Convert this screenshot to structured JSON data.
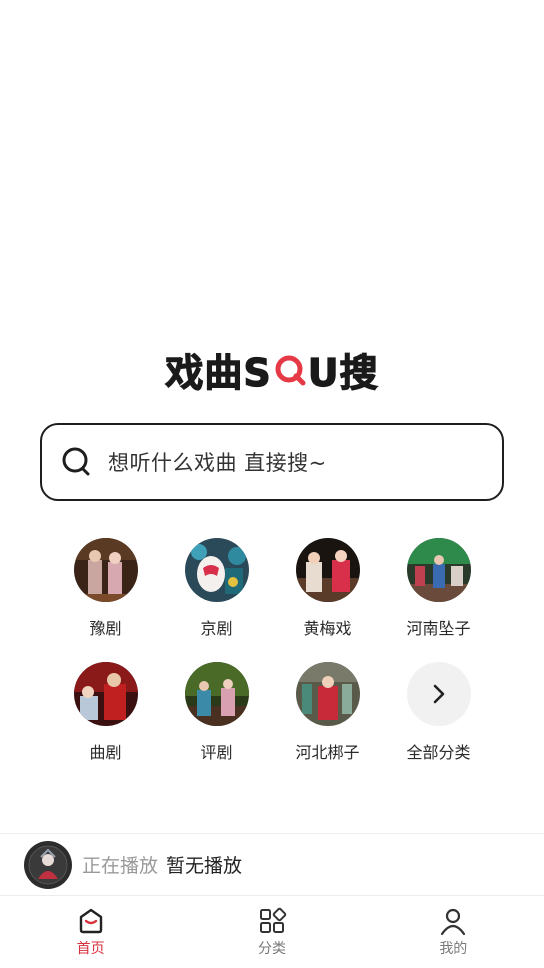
{
  "logo": {
    "part1": "戏曲S",
    "part2": "U搜"
  },
  "search": {
    "placeholder": "想听什么戏曲 直接搜~"
  },
  "categories": [
    {
      "label": "豫剧",
      "icon": "yuju-thumbnail"
    },
    {
      "label": "京剧",
      "icon": "jingju-thumbnail"
    },
    {
      "label": "黄梅戏",
      "icon": "huangmeixi-thumbnail"
    },
    {
      "label": "河南坠子",
      "icon": "henanzhuizi-thumbnail"
    },
    {
      "label": "曲剧",
      "icon": "quju-thumbnail"
    },
    {
      "label": "评剧",
      "icon": "pingju-thumbnail"
    },
    {
      "label": "河北梆子",
      "icon": "hebeibangzi-thumbnail"
    },
    {
      "label": "全部分类",
      "icon": "chevron-right-icon"
    }
  ],
  "player": {
    "status": "正在播放",
    "track": "暂无播放"
  },
  "tabs": [
    {
      "label": "首页",
      "icon": "home-icon",
      "active": true
    },
    {
      "label": "分类",
      "icon": "category-grid-icon",
      "active": false
    },
    {
      "label": "我的",
      "icon": "user-icon",
      "active": false
    }
  ],
  "colors": {
    "accent": "#d9303f",
    "logo_q_ring": "#e63946",
    "border": "#1e1e1e"
  }
}
